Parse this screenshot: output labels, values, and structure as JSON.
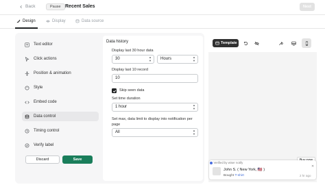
{
  "header": {
    "back_label": "Back",
    "pause_label": "Pause",
    "title": "Recent Sales",
    "next_label": "Next"
  },
  "tabs": [
    {
      "label": "Design",
      "icon": "brush-icon",
      "active": true
    },
    {
      "label": "Display",
      "icon": "eye-icon",
      "active": false
    },
    {
      "label": "Data source",
      "icon": "database-icon",
      "active": false
    }
  ],
  "sidebar": {
    "items": [
      {
        "label": "Text editor",
        "icon": "text-editor-icon"
      },
      {
        "label": "Click actions",
        "icon": "cursor-icon"
      },
      {
        "label": "Position & animation",
        "icon": "position-icon"
      },
      {
        "label": "Style",
        "icon": "palette-icon"
      },
      {
        "label": "Embed code",
        "icon": "code-icon"
      },
      {
        "label": "Data control",
        "icon": "database-icon",
        "active": true
      },
      {
        "label": "Timing control",
        "icon": "clock-icon"
      },
      {
        "label": "Verify label",
        "icon": "verify-icon"
      }
    ],
    "discard_label": "Discard",
    "save_label": "Save"
  },
  "form": {
    "section_title": "Data history",
    "display_last_hour_label": "Display last 30 hour data",
    "hour_value": "30",
    "unit_value": "Hours",
    "display_last_record_label": "Display last 10 record",
    "record_value": "10",
    "skip_seen_label": "Skip seen data",
    "skip_seen_checked": true,
    "time_duration_label": "Set time duration",
    "time_duration_value": "1 hour",
    "max_limit_label": "Set max, data limit to display into notification per page",
    "max_limit_value": "All"
  },
  "preview": {
    "template_label": "Template",
    "buy_now_label": "Buy now",
    "verified_label": "Verified by wiser notify",
    "notif_name": "John S. ( New York,",
    "notif_flag": "🇺🇸",
    "notif_name_end": ")",
    "notif_bought": "Bought",
    "notif_product": "T-shirt",
    "notif_time": "2 hr ago"
  },
  "colors": {
    "accent_save": "#1a7e5b",
    "template_button": "#303030"
  }
}
